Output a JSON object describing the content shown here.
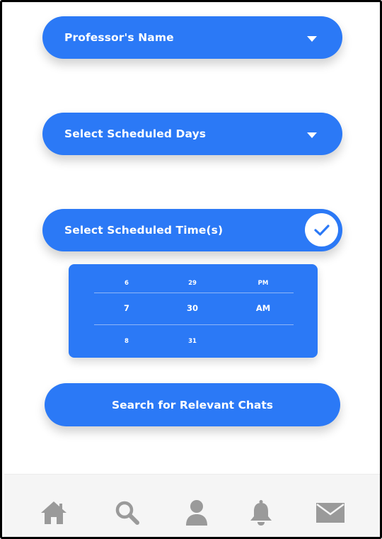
{
  "form": {
    "professor_label": "Professor's Name",
    "days_label": "Select Scheduled Days",
    "time_label": "Select Scheduled Time(s)"
  },
  "time_picker": {
    "hours": [
      "6",
      "7",
      "8"
    ],
    "minutes": [
      "29",
      "30",
      "31"
    ],
    "periods": [
      "PM",
      "AM"
    ]
  },
  "search_button": {
    "label": "Search for Relevant Chats"
  },
  "tab_bar": {
    "items": [
      {
        "icon": "home-icon"
      },
      {
        "icon": "search-icon"
      },
      {
        "icon": "profile-icon"
      },
      {
        "icon": "bell-icon"
      },
      {
        "icon": "mail-icon"
      }
    ],
    "icon_color": "#9a9a9a"
  },
  "colors": {
    "primary": "#2b79f6",
    "icon_gray": "#9a9a9a"
  }
}
